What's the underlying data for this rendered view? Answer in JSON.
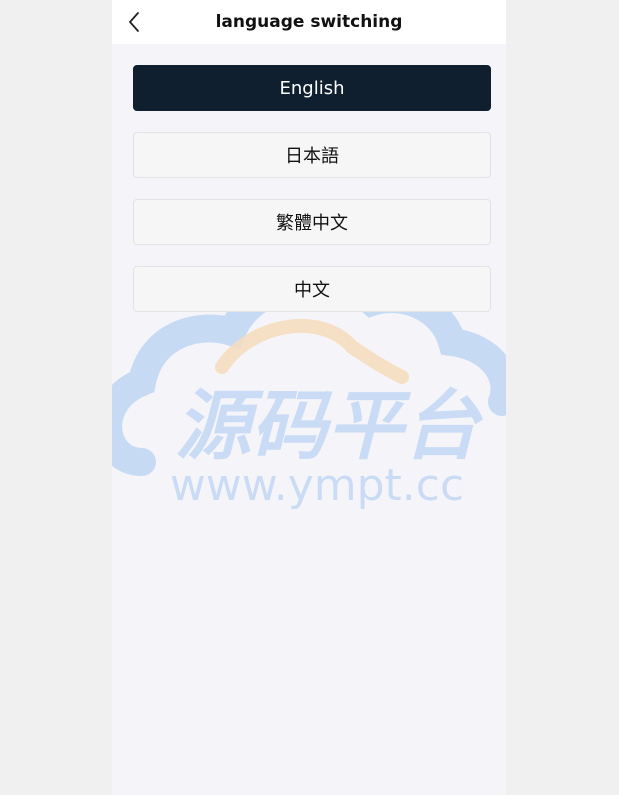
{
  "header": {
    "back_icon": "chevron-left-icon",
    "title": "language switching"
  },
  "languages": [
    {
      "label": "English",
      "selected": true
    },
    {
      "label": "日本語",
      "selected": false
    },
    {
      "label": "繁體中文",
      "selected": false
    },
    {
      "label": "中文",
      "selected": false
    }
  ],
  "watermark": {
    "title": "源码平台",
    "url": "www.ympt.cc"
  },
  "colors": {
    "selected_bg": "#0f1f30",
    "page_bg": "#f5f5f9",
    "watermark_blue": "#b7d0f2",
    "watermark_orange": "#f5dcbc"
  }
}
